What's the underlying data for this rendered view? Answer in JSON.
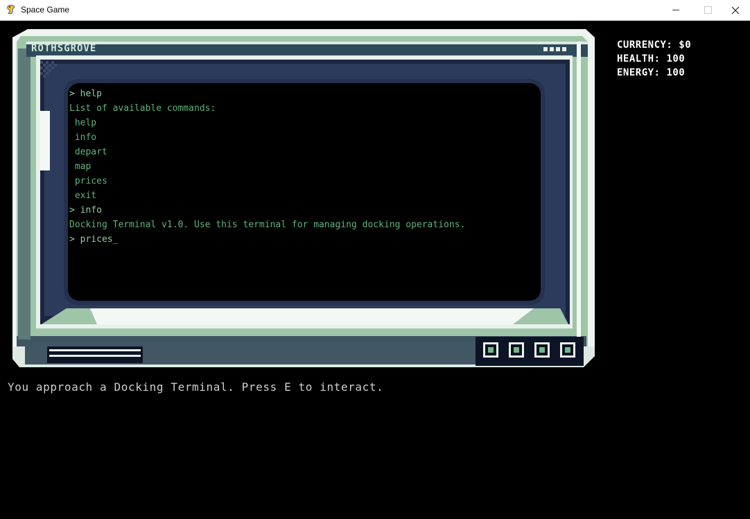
{
  "window": {
    "title": "Space Game",
    "controls": {
      "minimize": "minimize",
      "maximize": "maximize",
      "close": "✕"
    }
  },
  "hud": {
    "currency_label": "CURRENCY:",
    "currency_value": "$0",
    "health_label": "HEALTH:",
    "health_value": "100",
    "energy_label": "ENERGY:",
    "energy_value": "100"
  },
  "terminal": {
    "station_name": "ROTHSGROVE",
    "lines": [
      {
        "kind": "command",
        "text": "> help"
      },
      {
        "kind": "output",
        "text": "List of available commands:"
      },
      {
        "kind": "output",
        "text": " help"
      },
      {
        "kind": "output",
        "text": " info"
      },
      {
        "kind": "output",
        "text": " depart"
      },
      {
        "kind": "output",
        "text": " map"
      },
      {
        "kind": "output",
        "text": " prices"
      },
      {
        "kind": "output",
        "text": " exit"
      },
      {
        "kind": "command",
        "text": "> info"
      },
      {
        "kind": "output",
        "text": "Docking Terminal v1.0. Use this terminal for managing docking operations."
      },
      {
        "kind": "command",
        "text": "> prices_"
      }
    ],
    "indicator_count": 4
  },
  "message": "You approach a Docking Terminal. Press E to interact.",
  "colors": {
    "screen_text": "#5fb37a",
    "frame_light": "#e8f1ec",
    "frame_green": "#9cc2a6",
    "frame_navy": "#1b2540"
  }
}
